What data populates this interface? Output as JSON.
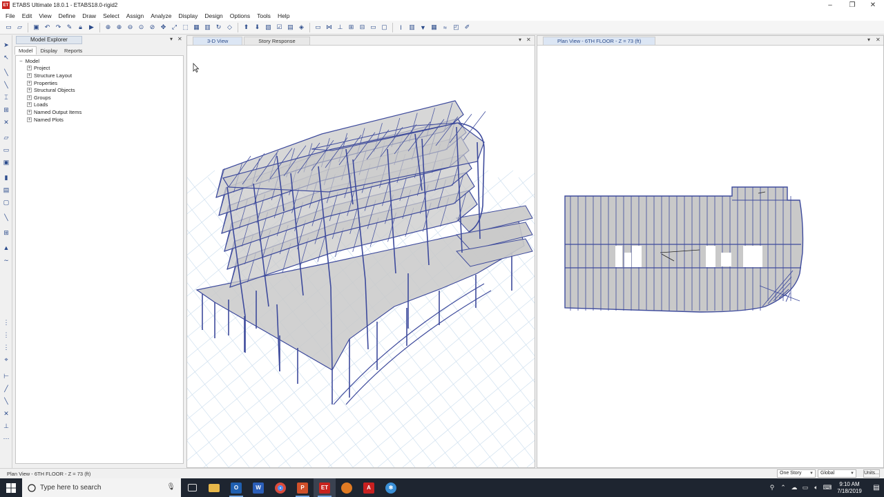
{
  "window": {
    "title": "ETABS Ultimate 18.0.1 - ETABS18.0-rigid2",
    "logo_text": "ET"
  },
  "menu": [
    "File",
    "Edit",
    "View",
    "Define",
    "Draw",
    "Select",
    "Assign",
    "Analyze",
    "Display",
    "Design",
    "Options",
    "Tools",
    "Help"
  ],
  "explorer": {
    "title": "Model Explorer",
    "tabs": [
      "Model",
      "Display",
      "Reports"
    ],
    "root": "Model",
    "items": [
      "Project",
      "Structure Layout",
      "Properties",
      "Structural Objects",
      "Groups",
      "Loads",
      "Named Output Items",
      "Named Plots"
    ]
  },
  "view3d": {
    "tabs": [
      "3-D View",
      "Story Response"
    ]
  },
  "planview": {
    "tab": "Plan View - 6TH FLOOR - Z = 73 (ft)"
  },
  "status": {
    "text": "Plan View - 6TH FLOOR - Z = 73 (ft)",
    "story_select": "One Story",
    "coord_select": "Global",
    "units_button": "Units..."
  },
  "taskbar": {
    "search_placeholder": "Type here to search",
    "time": "9:10 AM",
    "date": "7/18/2019"
  },
  "colors": {
    "frame_blue": "#3d4a9c",
    "slab_gray": "#c9c9c9",
    "grid_line": "#cfe0ef"
  }
}
